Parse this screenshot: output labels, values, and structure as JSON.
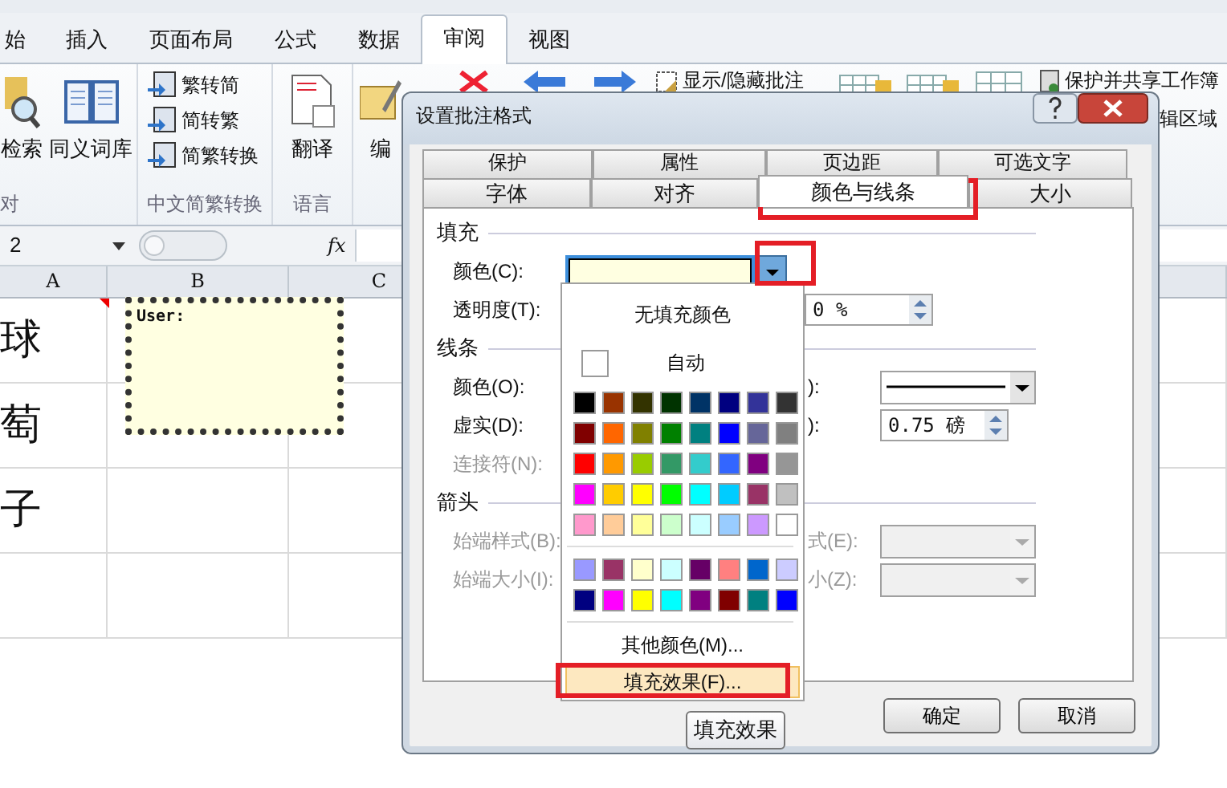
{
  "ribbon": {
    "tabs": [
      {
        "label": "始",
        "selected": false
      },
      {
        "label": "插入",
        "selected": false
      },
      {
        "label": "页面布局",
        "selected": false
      },
      {
        "label": "公式",
        "selected": false
      },
      {
        "label": "数据",
        "selected": false
      },
      {
        "label": "审阅",
        "selected": true
      },
      {
        "label": "视图",
        "selected": false
      }
    ],
    "proofing": {
      "research": "检索",
      "thesaurus": "同义词库",
      "group_label": "对"
    },
    "conversion": {
      "items": [
        "繁转简",
        "简转繁",
        "简繁转换"
      ],
      "group_label": "中文简繁转换"
    },
    "language": {
      "translate": "翻译",
      "group_label": "语言"
    },
    "comments": {
      "edit": "编",
      "show_hide": "显示/隐藏批注"
    },
    "changes": {
      "protect_share": "保护并共享工作簿",
      "edit_ranges": "辑区域"
    }
  },
  "formula_bar": {
    "name_box": "2",
    "function_label": "fx"
  },
  "sheet": {
    "columns": [
      "A",
      "B",
      "C"
    ],
    "rows": [
      {
        "cell": "球"
      },
      {
        "cell": "萄"
      },
      {
        "cell": "子"
      }
    ],
    "comment": {
      "text": "User:"
    }
  },
  "dialog": {
    "title": "设置批注格式",
    "tabs_back": [
      {
        "label": "保护",
        "selected": false
      },
      {
        "label": "属性",
        "selected": false
      },
      {
        "label": "页边距",
        "selected": false
      },
      {
        "label": "可选文字",
        "selected": false
      }
    ],
    "tabs_front": [
      {
        "label": "字体",
        "selected": false
      },
      {
        "label": "对齐",
        "selected": false
      },
      {
        "label": "颜色与线条",
        "selected": true
      },
      {
        "label": "大小",
        "selected": false
      }
    ],
    "sections": [
      {
        "title": "填充",
        "rows": [
          {
            "label": "颜色(C):",
            "disabled": false,
            "kind": "color"
          },
          {
            "label": "透明度(T):",
            "disabled": false,
            "kind": "plain",
            "side": {
              "kind": "spinner",
              "value": "0 %",
              "disabled": false
            }
          }
        ]
      },
      {
        "title": "线条",
        "rows": [
          {
            "label": "颜色(O):",
            "disabled": false,
            "side": {
              "label": "):",
              "kind": "line",
              "disabled": false
            }
          },
          {
            "label": "虚实(D):",
            "disabled": false,
            "side": {
              "label": "):",
              "kind": "spinner",
              "value": "0.75 磅",
              "disabled": false
            }
          },
          {
            "label": "连接符(N):",
            "disabled": true
          }
        ]
      },
      {
        "title": "箭头",
        "rows": [
          {
            "label": "始端样式(B):",
            "disabled": true,
            "side": {
              "label": "式(E):",
              "kind": "select",
              "disabled": true
            }
          },
          {
            "label": "始端大小(I):",
            "disabled": true,
            "side": {
              "label": "小(Z):",
              "kind": "select",
              "disabled": true
            }
          }
        ]
      }
    ],
    "buttons": [
      "确定",
      "取消"
    ],
    "tooltip": "填充效果"
  },
  "color_menu": {
    "no_fill": "无填充颜色",
    "automatic": "自动",
    "standard": [
      {
        "swatches": [
          {
            "color": "#000000"
          },
          {
            "color": "#993300"
          },
          {
            "color": "#333300"
          },
          {
            "color": "#003300"
          },
          {
            "color": "#003366"
          },
          {
            "color": "#000080"
          },
          {
            "color": "#333399"
          },
          {
            "color": "#333333"
          }
        ]
      },
      {
        "swatches": [
          {
            "color": "#800000"
          },
          {
            "color": "#ff6600"
          },
          {
            "color": "#808000"
          },
          {
            "color": "#008000"
          },
          {
            "color": "#008080"
          },
          {
            "color": "#0000ff"
          },
          {
            "color": "#666699"
          },
          {
            "color": "#808080"
          }
        ]
      },
      {
        "swatches": [
          {
            "color": "#ff0000"
          },
          {
            "color": "#ff9900"
          },
          {
            "color": "#99cc00"
          },
          {
            "color": "#339966"
          },
          {
            "color": "#33cccc"
          },
          {
            "color": "#3366ff"
          },
          {
            "color": "#800080"
          },
          {
            "color": "#969696"
          }
        ]
      },
      {
        "swatches": [
          {
            "color": "#ff00ff"
          },
          {
            "color": "#ffcc00"
          },
          {
            "color": "#ffff00"
          },
          {
            "color": "#00ff00"
          },
          {
            "color": "#00ffff"
          },
          {
            "color": "#00ccff"
          },
          {
            "color": "#993366"
          },
          {
            "color": "#c0c0c0"
          }
        ]
      },
      {
        "swatches": [
          {
            "color": "#ff99cc"
          },
          {
            "color": "#ffcc99"
          },
          {
            "color": "#ffff99"
          },
          {
            "color": "#ccffcc"
          },
          {
            "color": "#ccffff"
          },
          {
            "color": "#99ccff"
          },
          {
            "color": "#cc99ff"
          },
          {
            "color": "#ffffff"
          }
        ]
      }
    ],
    "extra": [
      {
        "swatches": [
          {
            "color": "#9999ff"
          },
          {
            "color": "#993366"
          },
          {
            "color": "#ffffcc"
          },
          {
            "color": "#ccffff"
          },
          {
            "color": "#660066"
          },
          {
            "color": "#ff8080"
          },
          {
            "color": "#0066cc"
          },
          {
            "color": "#ccccff"
          }
        ]
      },
      {
        "swatches": [
          {
            "color": "#000080"
          },
          {
            "color": "#ff00ff"
          },
          {
            "color": "#ffff00"
          },
          {
            "color": "#00ffff"
          },
          {
            "color": "#800080"
          },
          {
            "color": "#800000"
          },
          {
            "color": "#008080"
          },
          {
            "color": "#0000ff"
          }
        ]
      }
    ],
    "more_colors": "其他颜色(M)...",
    "fill_effects": {
      "label": "填充效果(F)...",
      "hovered": true
    }
  }
}
